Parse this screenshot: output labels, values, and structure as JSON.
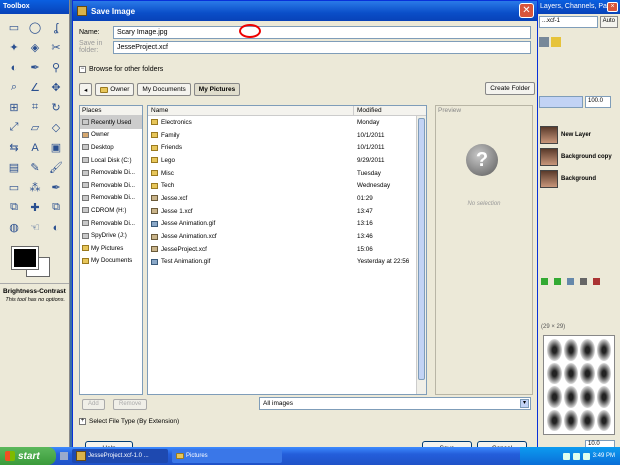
{
  "toolbox": {
    "title": "Toolbox",
    "tools": [
      "rect-select-icon",
      "ellipse-select-icon",
      "lasso-icon",
      "fuzzy-select-icon",
      "color-select-icon",
      "scissors-icon",
      "fg-select-icon",
      "paths-icon",
      "color-picker-icon",
      "zoom-icon",
      "measure-icon",
      "move-icon",
      "align-icon",
      "crop-icon",
      "rotate-icon",
      "scale-icon",
      "shear-icon",
      "perspective-icon",
      "flip-icon",
      "text-icon",
      "bucket-fill-icon",
      "blend-icon",
      "pencil-icon",
      "paintbrush-icon",
      "eraser-icon",
      "airbrush-icon",
      "ink-icon",
      "clone-icon",
      "heal-icon",
      "perspective-clone-icon",
      "blur-icon",
      "smudge-icon",
      "dodge-icon"
    ],
    "options_title": "Brightness-Contrast",
    "options_text": "This tool has no options."
  },
  "dock": {
    "title": "Layers, Channels, Paths, Undo",
    "image_select": "...xcf-1",
    "auto_label": "Auto",
    "opacity": "100.0",
    "layers": [
      {
        "name": "New Layer"
      },
      {
        "name": "Background copy"
      },
      {
        "name": "Background"
      }
    ],
    "brush_info": "(29 × 29)",
    "spacing": "10.0"
  },
  "dialog": {
    "title": "Save Image",
    "name_label": "Name:",
    "name_value": "Scary Image.jpg",
    "save_in_label": "Save in folder:",
    "save_in_value": "JesseProject.xcf",
    "browse_label": "Browse for other folders",
    "path": [
      "Owner",
      "My Documents",
      "My Pictures"
    ],
    "create_folder": "Create Folder",
    "places_header": "Places",
    "places": [
      {
        "label": "Recently Used",
        "icon": "recent-icon"
      },
      {
        "label": "Owner",
        "icon": "home-folder-icon"
      },
      {
        "label": "Desktop",
        "icon": "desktop-icon"
      },
      {
        "label": "Local Disk (C:)",
        "icon": "drive-icon"
      },
      {
        "label": "Removable Di...",
        "icon": "removable-drive-icon"
      },
      {
        "label": "Removable Di...",
        "icon": "removable-drive-icon"
      },
      {
        "label": "Removable Di...",
        "icon": "removable-drive-icon"
      },
      {
        "label": "CDROM (H:)",
        "icon": "cdrom-icon"
      },
      {
        "label": "Removable Di...",
        "icon": "removable-drive-icon"
      },
      {
        "label": "SpyDrive (J:)",
        "icon": "drive-icon"
      },
      {
        "label": "My Pictures",
        "icon": "folder-icon"
      },
      {
        "label": "My Documents",
        "icon": "folder-icon"
      }
    ],
    "columns": {
      "name": "Name",
      "modified": "Modified"
    },
    "files": [
      {
        "name": "Electronics",
        "modified": "Monday",
        "type": "folder"
      },
      {
        "name": "Family",
        "modified": "10/1/2011",
        "type": "folder"
      },
      {
        "name": "Friends",
        "modified": "10/1/2011",
        "type": "folder"
      },
      {
        "name": "Lego",
        "modified": "9/29/2011",
        "type": "folder"
      },
      {
        "name": "Misc",
        "modified": "Tuesday",
        "type": "folder"
      },
      {
        "name": "Tech",
        "modified": "Wednesday",
        "type": "folder"
      },
      {
        "name": "Jesse.xcf",
        "modified": "01:29",
        "type": "xcf"
      },
      {
        "name": "Jesse 1.xcf",
        "modified": "13:47",
        "type": "xcf"
      },
      {
        "name": "Jesse Animation.gif",
        "modified": "13:16",
        "type": "gif"
      },
      {
        "name": "Jesse Animation.xcf",
        "modified": "13:46",
        "type": "xcf"
      },
      {
        "name": "JesseProject.xcf",
        "modified": "15:06",
        "type": "xcf"
      },
      {
        "name": "Test Animation.gif",
        "modified": "Yesterday at 22:56",
        "type": "gif"
      }
    ],
    "preview_label": "Preview",
    "no_selection": "No selection",
    "add_label": "Add",
    "remove_label": "Remove",
    "filter_value": "All images",
    "file_type_label": "Select File Type (By Extension)",
    "help_label": "Help",
    "save_label": "Save",
    "cancel_label": "Cancel"
  },
  "taskbar": {
    "start_label": "start",
    "items": [
      "JesseProject.xcf-1.0 ...",
      "Pictures"
    ],
    "clock": "3:49 PM"
  }
}
